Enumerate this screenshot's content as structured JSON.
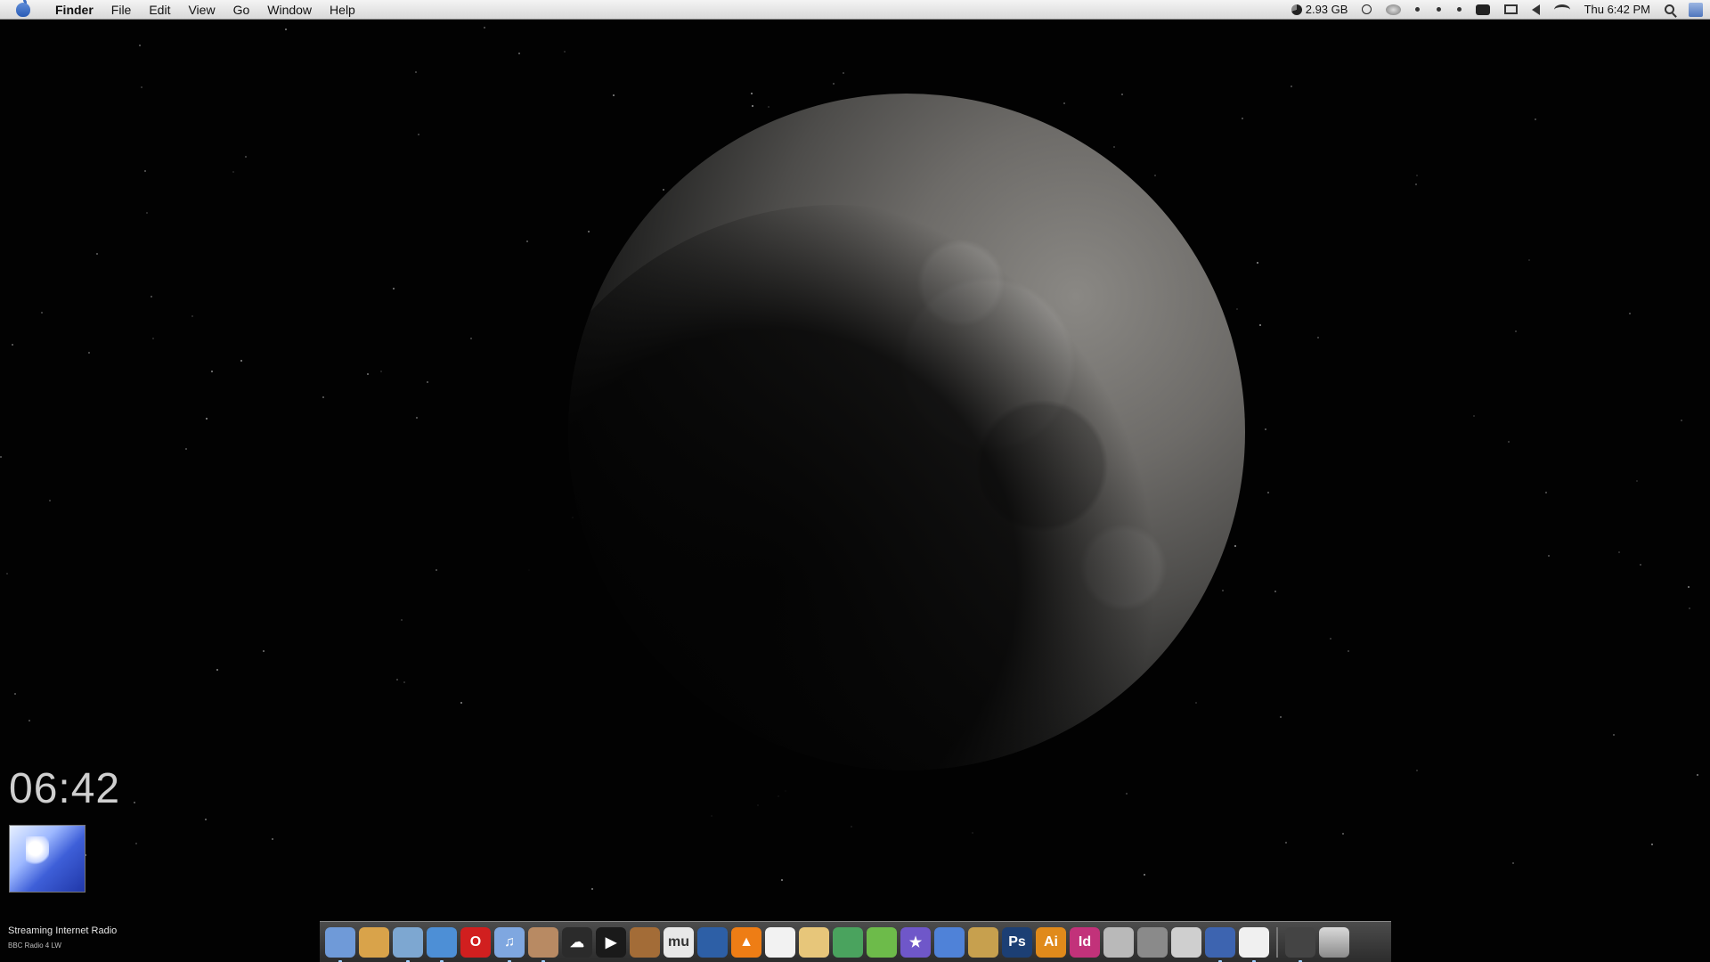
{
  "menubar": {
    "app_name": "Finder",
    "menus": [
      "File",
      "Edit",
      "View",
      "Go",
      "Window",
      "Help"
    ],
    "memory": "2.93 GB",
    "clock": "Thu 6:42 PM"
  },
  "widget": {
    "time": "06:42",
    "radio_title": "Streaming Internet Radio",
    "radio_station": "BBC Radio 4 LW"
  },
  "dock": {
    "items": [
      {
        "name": "finder",
        "color": "#6f9ad8",
        "glyph": ""
      },
      {
        "name": "transmit",
        "color": "#d9a34a",
        "glyph": ""
      },
      {
        "name": "preview",
        "color": "#7da7d1",
        "glyph": ""
      },
      {
        "name": "safari",
        "color": "#4d8fd6",
        "glyph": ""
      },
      {
        "name": "opera",
        "color": "#d11f1f",
        "glyph": "O"
      },
      {
        "name": "itunes",
        "color": "#7fa7e0",
        "glyph": "♫"
      },
      {
        "name": "jupiter",
        "color": "#b88a63",
        "glyph": ""
      },
      {
        "name": "cloud",
        "color": "#2b2b2b",
        "glyph": "☁"
      },
      {
        "name": "terminal",
        "color": "#1a1a1a",
        "glyph": "▶"
      },
      {
        "name": "garageband",
        "color": "#a36c37",
        "glyph": ""
      },
      {
        "name": "mu",
        "color": "#e8e8e8",
        "glyph": "mu"
      },
      {
        "name": "feather",
        "color": "#2d5fa6",
        "glyph": ""
      },
      {
        "name": "vlc",
        "color": "#ee7d15",
        "glyph": "▲"
      },
      {
        "name": "textedit",
        "color": "#f2f2f2",
        "glyph": ""
      },
      {
        "name": "pages",
        "color": "#e7c67a",
        "glyph": ""
      },
      {
        "name": "numbers",
        "color": "#4aa35e",
        "glyph": ""
      },
      {
        "name": "network",
        "color": "#6dbb4a",
        "glyph": ""
      },
      {
        "name": "imovie",
        "color": "#6f57c9",
        "glyph": "★"
      },
      {
        "name": "document",
        "color": "#4f82d8",
        "glyph": ""
      },
      {
        "name": "paint",
        "color": "#c7a04e",
        "glyph": ""
      },
      {
        "name": "photoshop",
        "color": "#1c3f74",
        "glyph": "Ps"
      },
      {
        "name": "illustrator",
        "color": "#e08a1b",
        "glyph": "Ai"
      },
      {
        "name": "indesign",
        "color": "#c2327a",
        "glyph": "Id"
      },
      {
        "name": "system-prefs",
        "color": "#b9b9b9",
        "glyph": ""
      },
      {
        "name": "disk-utility",
        "color": "#8a8a8a",
        "glyph": ""
      },
      {
        "name": "calculator",
        "color": "#cfcfcf",
        "glyph": ""
      },
      {
        "name": "spaces",
        "color": "#3d64b0",
        "glyph": ""
      },
      {
        "name": "clock",
        "color": "#f0f0f0",
        "glyph": ""
      },
      {
        "name": "eject",
        "color": "#444",
        "glyph": ""
      }
    ]
  }
}
